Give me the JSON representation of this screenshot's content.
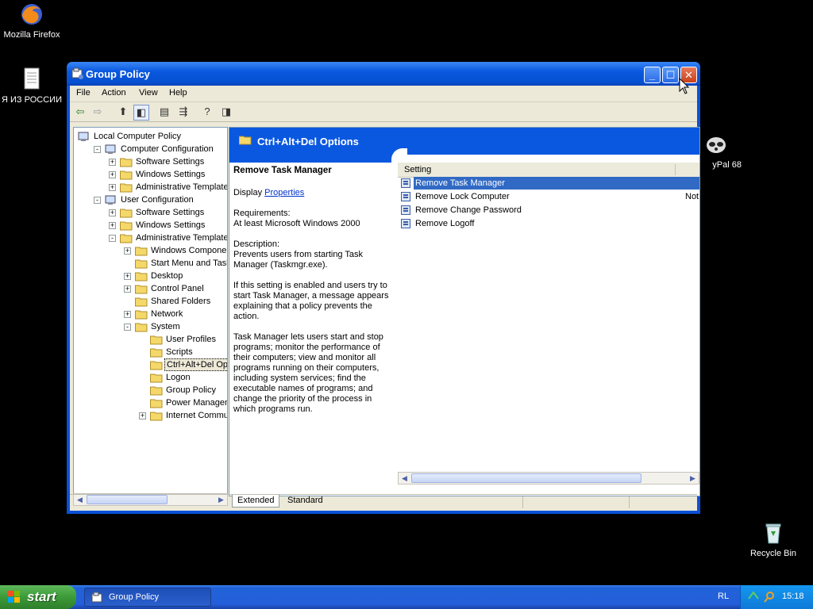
{
  "desktop": {
    "icons": [
      {
        "label": "Mozilla Firefox"
      },
      {
        "label": "Я ИЗ РОССИИ"
      },
      {
        "label": "yPal 68"
      },
      {
        "label": "Recycle Bin"
      }
    ]
  },
  "window": {
    "title": "Group Policy",
    "menu": [
      "File",
      "Action",
      "View",
      "Help"
    ],
    "tree": [
      {
        "label": "Local Computer Policy",
        "level": 0
      },
      {
        "label": "Computer Configuration",
        "level": 1
      },
      {
        "label": "Software Settings",
        "level": 2
      },
      {
        "label": "Windows Settings",
        "level": 2
      },
      {
        "label": "Administrative Templates",
        "level": 2
      },
      {
        "label": "User Configuration",
        "level": 1
      },
      {
        "label": "Software Settings",
        "level": 2
      },
      {
        "label": "Windows Settings",
        "level": 2
      },
      {
        "label": "Administrative Templates",
        "level": 2
      },
      {
        "label": "Windows Components",
        "level": 3
      },
      {
        "label": "Start Menu and Taskba",
        "level": 3
      },
      {
        "label": "Desktop",
        "level": 3
      },
      {
        "label": "Control Panel",
        "level": 3
      },
      {
        "label": "Shared Folders",
        "level": 3
      },
      {
        "label": "Network",
        "level": 3
      },
      {
        "label": "System",
        "level": 3
      },
      {
        "label": "User Profiles",
        "level": 4
      },
      {
        "label": "Scripts",
        "level": 4
      },
      {
        "label": "Ctrl+Alt+Del Optio",
        "level": 4
      },
      {
        "label": "Logon",
        "level": 4
      },
      {
        "label": "Group Policy",
        "level": 4
      },
      {
        "label": "Power Managemen",
        "level": 4
      },
      {
        "label": "Internet Communic",
        "level": 4
      }
    ],
    "banner_title": "Ctrl+Alt+Del Options",
    "description": {
      "heading": "Remove Task Manager",
      "display_prefix": "Display",
      "display_link": "Properties",
      "requirements_label": "Requirements:",
      "requirements": "At least Microsoft Windows 2000",
      "description_label": "Description:",
      "description_text": "Prevents users from starting Task Manager (Taskmgr.exe).",
      "para2": "If this setting is enabled and users try to start Task Manager, a message appears explaining that a policy prevents the action.",
      "para3": "Task Manager lets users start and stop programs; monitor the performance of their computers; view and monitor all programs running on their computers, including system services; find the executable names of programs; and change the priority of the process in which programs run."
    },
    "list": {
      "header_setting": "Setting",
      "rows": [
        {
          "label": "Remove Task Manager",
          "state": ""
        },
        {
          "label": "Remove Lock Computer",
          "state": "Not"
        },
        {
          "label": "Remove Change Password",
          "state": ""
        },
        {
          "label": "Remove Logoff",
          "state": ""
        }
      ]
    },
    "tabs": [
      "Extended",
      "Standard"
    ]
  },
  "taskbar": {
    "start_label": "start",
    "task_label": "Group Policy",
    "language": "RL",
    "clock": "15:18"
  }
}
